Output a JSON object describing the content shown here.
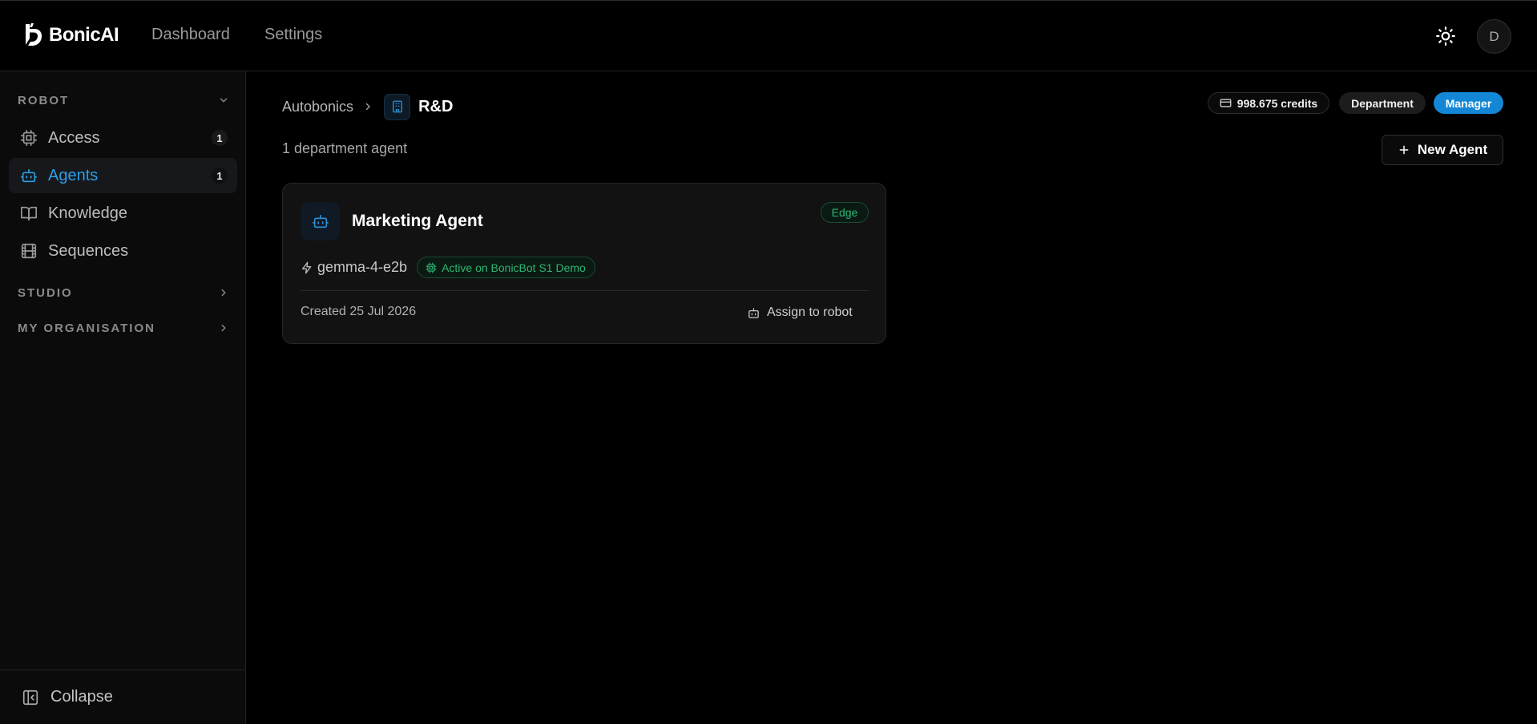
{
  "app": {
    "brand": "BonicAI"
  },
  "topnav": {
    "items": [
      {
        "label": "Dashboard"
      },
      {
        "label": "Settings"
      }
    ]
  },
  "user": {
    "avatar_initial": "D"
  },
  "sidebar": {
    "sections": [
      {
        "title": "ROBOT",
        "expanded": true
      },
      {
        "title": "STUDIO",
        "expanded": false
      },
      {
        "title": "MY ORGANISATION",
        "expanded": false
      }
    ],
    "items": [
      {
        "label": "Access",
        "badge": "1",
        "icon": "chip-icon"
      },
      {
        "label": "Agents",
        "badge": "1",
        "icon": "robot-icon",
        "active": true
      },
      {
        "label": "Knowledge",
        "icon": "book-icon"
      },
      {
        "label": "Sequences",
        "icon": "film-icon"
      }
    ],
    "collapse_label": "Collapse"
  },
  "breadcrumb": {
    "parent": "Autobonics",
    "current": "R&D"
  },
  "header_badges": {
    "credits": "998.675 credits",
    "scope": "Department",
    "role": "Manager"
  },
  "main": {
    "agent_count": "1 department agent",
    "new_agent_label": "New Agent"
  },
  "agents": [
    {
      "name": "Marketing Agent",
      "tag": "Edge",
      "model": "gemma-4-e2b",
      "status": "Active on BonicBot S1 Demo",
      "created": "Created 25 Jul 2026",
      "assign_label": "Assign to robot"
    }
  ],
  "colors": {
    "accent": "#1387d6",
    "active_nav": "#2b9fe6",
    "success": "#2fb573",
    "background": "#000000"
  }
}
